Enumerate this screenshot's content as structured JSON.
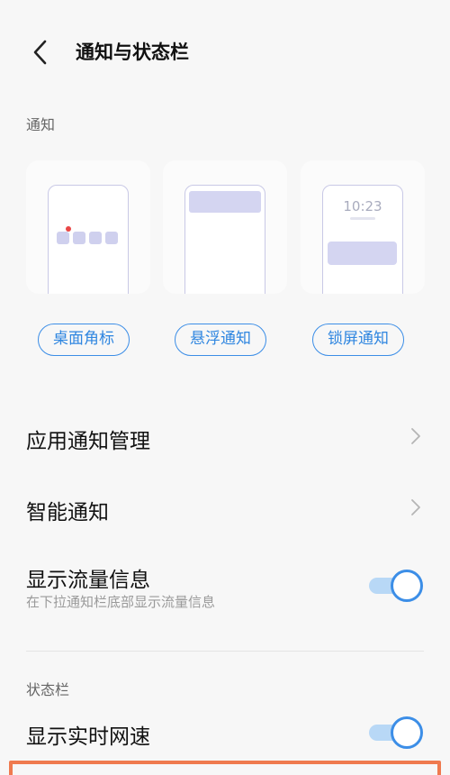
{
  "header": {
    "title": "通知与状态栏",
    "back_icon": "chevron-left-icon"
  },
  "notifications": {
    "section_label": "通知",
    "cards": [
      {
        "label": "桌面角标",
        "illustration": "badge-illustration"
      },
      {
        "label": "悬浮通知",
        "illustration": "floating-notification-illustration"
      },
      {
        "label": "锁屏通知",
        "illustration": "lockscreen-notification-illustration",
        "clock": "10:23"
      }
    ]
  },
  "settings": {
    "app_notification_mgmt": "应用通知管理",
    "smart_notification": "智能通知",
    "show_traffic": {
      "title": "显示流量信息",
      "subtitle": "在下拉通知栏底部显示流量信息",
      "enabled": true
    }
  },
  "status_bar": {
    "section_label": "状态栏",
    "realtime_speed": {
      "title": "显示实时网速",
      "enabled": true
    }
  },
  "colors": {
    "accent": "#3c8ee7",
    "highlight": "#ef7a4f",
    "card_fill": "#d4d5f1"
  }
}
